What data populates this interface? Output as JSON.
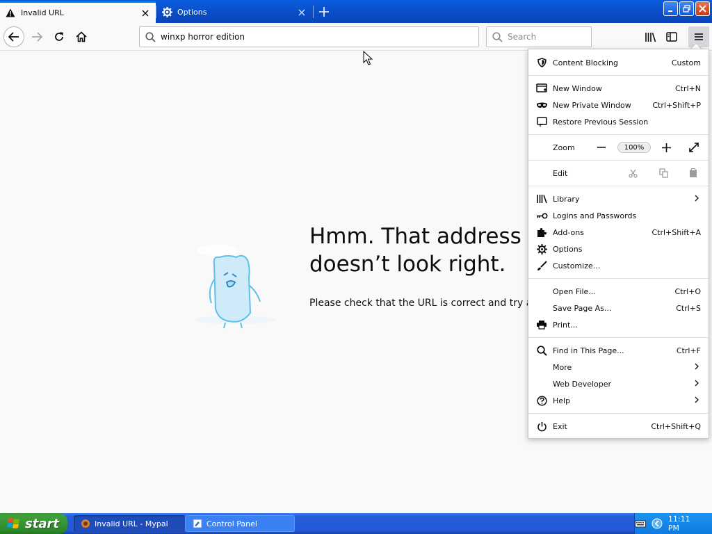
{
  "tabs": [
    {
      "label": "Invalid URL",
      "icon": "warning-icon",
      "active": true
    },
    {
      "label": "Options",
      "icon": "gear-icon",
      "active": false
    }
  ],
  "urlbar": {
    "value": "winxp horror edition"
  },
  "searchbar": {
    "placeholder": "Search"
  },
  "error": {
    "title_line1": "Hmm. That address",
    "title_line2": "doesn’t look right.",
    "description": "Please check that the URL is correct and try again."
  },
  "menu": {
    "content_blocking": {
      "label": "Content Blocking",
      "value": "Custom"
    },
    "new_window": {
      "label": "New Window",
      "shortcut": "Ctrl+N"
    },
    "new_private_window": {
      "label": "New Private Window",
      "shortcut": "Ctrl+Shift+P"
    },
    "restore_session": {
      "label": "Restore Previous Session"
    },
    "zoom": {
      "label": "Zoom",
      "value": "100%"
    },
    "edit": {
      "label": "Edit"
    },
    "library": {
      "label": "Library"
    },
    "logins": {
      "label": "Logins and Passwords"
    },
    "addons": {
      "label": "Add-ons",
      "shortcut": "Ctrl+Shift+A"
    },
    "options": {
      "label": "Options"
    },
    "customize": {
      "label": "Customize..."
    },
    "open_file": {
      "label": "Open File...",
      "shortcut": "Ctrl+O"
    },
    "save_page": {
      "label": "Save Page As...",
      "shortcut": "Ctrl+S"
    },
    "print": {
      "label": "Print..."
    },
    "find": {
      "label": "Find in This Page...",
      "shortcut": "Ctrl+F"
    },
    "more": {
      "label": "More"
    },
    "web_developer": {
      "label": "Web Developer"
    },
    "help": {
      "label": "Help"
    },
    "exit": {
      "label": "Exit",
      "shortcut": "Ctrl+Shift+Q"
    }
  },
  "taskbar": {
    "start_label": "start",
    "buttons": [
      {
        "label": "Invalid URL - Mypal",
        "active": true
      },
      {
        "label": "Control Panel",
        "active": false
      }
    ],
    "clock": "11:11 PM"
  },
  "colors": {
    "accent": "#0a84ff",
    "titlebar": "#0a4bc4",
    "taskbar": "#245edb",
    "start": "#3c9b3c"
  }
}
